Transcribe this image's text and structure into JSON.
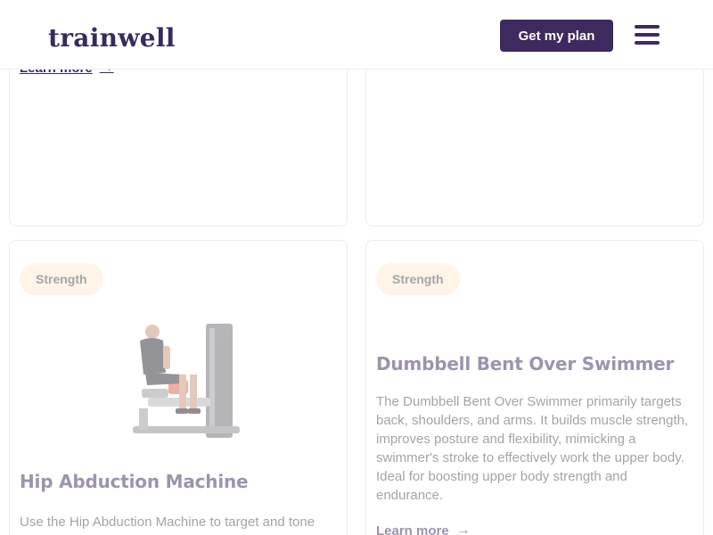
{
  "header": {
    "logo": "trainwell",
    "cta_label": "Get my plan"
  },
  "cards": {
    "top_left": {
      "learn_more": "Learn more"
    },
    "bottom_left": {
      "tag": "Strength",
      "title": "Hip Abduction Machine",
      "description": "Use the Hip Abduction Machine to target and tone",
      "image_alt": "Man seated on hip abduction machine"
    },
    "bottom_right": {
      "tag": "Strength",
      "title": "Dumbbell Bent Over Swimmer",
      "description": "The Dumbbell Bent Over Swimmer primarily targets back, shoulders, and arms. It builds muscle strength, improves posture and flexibility, mimicking a swimmer's stroke to effectively work the upper body. Ideal for boosting upper body strength and endurance.",
      "learn_more": "Learn more"
    }
  },
  "icons": {
    "arrow": "→",
    "menu": "hamburger-icon"
  },
  "colors": {
    "brand": "#3d2a5e",
    "tag_bg": "#fde9cf"
  }
}
